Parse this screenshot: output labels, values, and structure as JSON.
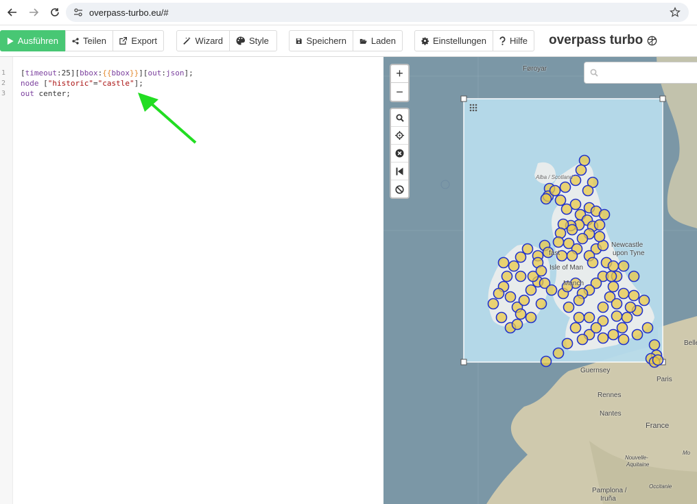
{
  "browser": {
    "url": "overpass-turbo.eu/#"
  },
  "toolbar": {
    "run_label": "Ausführen",
    "share_label": "Teilen",
    "export_label": "Export",
    "wizard_label": "Wizard",
    "style_label": "Style",
    "save_label": "Speichern",
    "load_label": "Laden",
    "settings_label": "Einstellungen",
    "help_label": "Hilfe",
    "app_title": "overpass turbo"
  },
  "editor": {
    "line_numbers": [
      "1",
      "2",
      "3"
    ],
    "line1": {
      "a": "[",
      "b": "timeout",
      "c": ":25][",
      "d": "bbox",
      "e": ":",
      "f": "{{",
      "g": "bbox",
      "h": "}}",
      "i": "][",
      "j": "out",
      "k": ":",
      "l": "json",
      "m": "];"
    },
    "line2": {
      "a": "node",
      "b": " [",
      "c": "\"historic\"",
      "d": "=",
      "e": "\"castle\"",
      "f": "];"
    },
    "line3": {
      "a": "out",
      "b": " center;"
    }
  },
  "map": {
    "search_placeholder": "",
    "labels": {
      "faroe": "Føroyar",
      "alba": "Alba / Scotland",
      "newcastle1": "Newcastle",
      "newcastle2": "upon Tyne",
      "belfast": "fast",
      "isle_of_man": "Isle of Man",
      "manchester": "Manch",
      "guernsey": "Guernsey",
      "rennes": "Rennes",
      "nantes": "Nantes",
      "paris": "Paris",
      "france": "France",
      "nouvelle1": "Nouvelle-",
      "nouvelle2": "Aquitaine",
      "occitanie": "Occitanie",
      "pamplona1": "Pamplona /",
      "pamplona2": "Iruña",
      "belle": "Belle",
      "ma": "Mo"
    }
  },
  "colors": {
    "run_green": "#48c774",
    "sea": "#7b97a6",
    "bbox_fill": "#b8dcec",
    "marker_stroke": "#2233cc",
    "marker_fill": "#e9c94a",
    "arrow": "#22dd22"
  },
  "icons": {
    "back": "arrow-left-icon",
    "forward": "arrow-right-icon",
    "reload": "reload-icon",
    "site_info": "tune-icon",
    "bookmark": "star-icon",
    "run": "play-icon",
    "share": "share-icon",
    "export": "external-link-icon",
    "wizard": "magic-wand-icon",
    "style": "palette-icon",
    "save": "floppy-icon",
    "load": "folder-open-icon",
    "settings": "gear-icon",
    "help": "question-icon",
    "logo": "overpass-logo-icon"
  }
}
